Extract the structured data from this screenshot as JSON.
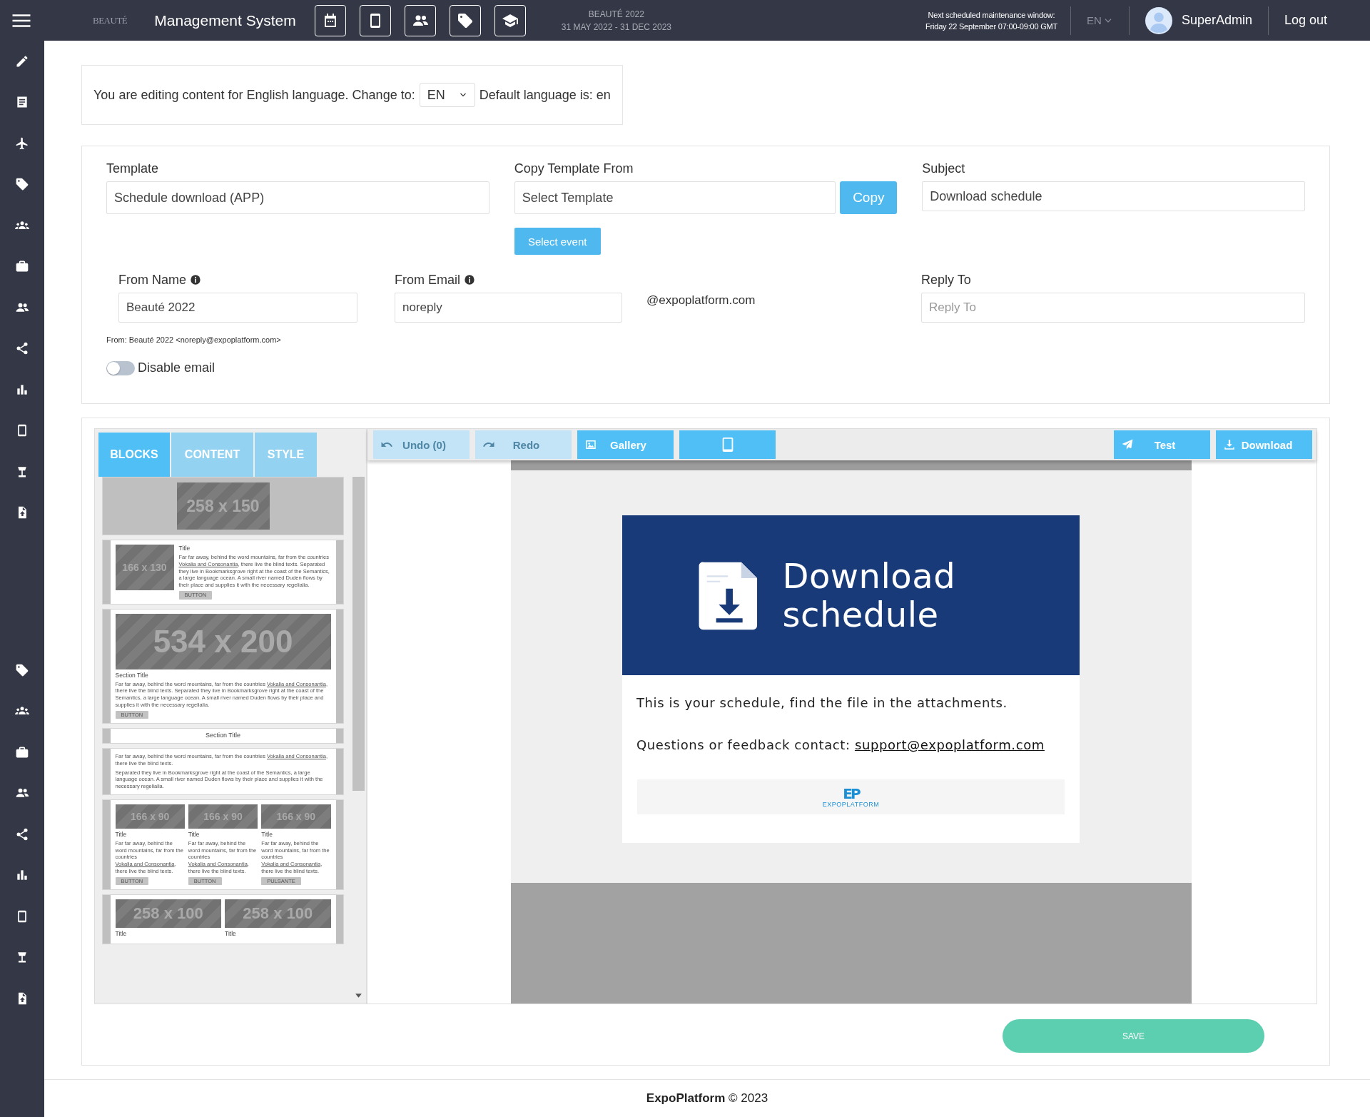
{
  "topbar": {
    "logo": "BEAUTÉ",
    "title": "Management System",
    "event_name": "BEAUTÉ 2022",
    "event_dates": "31 MAY 2022 - 31 DEC 2023",
    "maintenance_title": "Next scheduled maintenance window:",
    "maintenance_time": "Friday 22 September 07:00-09:00 GMT",
    "language": "EN",
    "user": "SuperAdmin",
    "logout": "Log out"
  },
  "language_bar": {
    "text": "You are editing content for English language. Change to:",
    "language": "EN",
    "default_text": "Default language is: en"
  },
  "form": {
    "template": {
      "label": "Template",
      "value": "Schedule download (APP)"
    },
    "copy_from": {
      "label": "Copy Template From",
      "value": "Select Template",
      "button": "Copy"
    },
    "subject": {
      "label": "Subject",
      "value": "Download schedule"
    },
    "select_event": "Select event",
    "from_name": {
      "label": "From Name",
      "value": "Beauté 2022"
    },
    "from_email": {
      "label": "From Email",
      "value": "noreply",
      "domain": "@expoplatform.com"
    },
    "reply_to": {
      "label": "Reply To",
      "placeholder": "Reply To"
    },
    "from_preview": "From: Beauté 2022 <noreply@expoplatform.com>",
    "disable_email": {
      "label": "Disable email",
      "on": false
    }
  },
  "editor": {
    "tabs": [
      {
        "label": "BLOCKS",
        "selected": true
      },
      {
        "label": "CONTENT",
        "selected": false
      },
      {
        "label": "STYLE",
        "selected": false
      }
    ],
    "blocks": [
      {
        "kind": "image",
        "image": "258 x 150"
      },
      {
        "kind": "image-text",
        "image": "166 x 130",
        "title": "Title",
        "text": "Far far away, behind the word mountains, far from the countries",
        "link": "Vokalia and Consonantia",
        "after": ", there live the blind texts. Separated they live in Bookmarksgrove right at the coast of the Semantics, a large language ocean. A small river named Duden flows by their place and supplies it with the necessary regelialia.",
        "button": "BUTTON"
      },
      {
        "kind": "hero",
        "image": "534 x 200",
        "title": "Section Title",
        "text": "Far far away, behind the word mountains, far from the countries",
        "link": "Vokalia and Consonantia",
        "after": ", there live the blind texts. Separated they live in Bookmarksgrove right at the coast of the Semantics, a large language ocean. A small river named Duden flows by their place and supplies it with the necessary regelialia.",
        "button": "BUTTON"
      },
      {
        "kind": "heading",
        "title": "Section Title"
      },
      {
        "kind": "text",
        "text": "Far far away, behind the word mountains, far from the countries",
        "link": "Vokalia and Consonantia",
        "after": ", there live the blind texts.",
        "paragraph_2": "Separated they live in Bookmarksgrove right at the coast of the Semantics, a large language ocean. A small river named Duden flows by their place and supplies it with the necessary regelialia."
      },
      {
        "kind": "columns",
        "columns": [
          {
            "image": "166 x 90",
            "title": "Title",
            "text": "Far far away, behind the word mountains, far from the countries",
            "link": "Vokalia and Consonantia",
            "after": ", there live the blind texts.",
            "button": "BUTTON"
          },
          {
            "image": "166 x 90",
            "title": "Title",
            "text": "Far far away, behind the word mountains, far from the countries",
            "link": "Vokalia and Consonantia",
            "after": ", there live the blind texts.",
            "button": "BUTTON"
          },
          {
            "image": "166 x 90",
            "title": "Title",
            "text": "Far far away, behind the word mountains, far from the countries",
            "link": "Vokalia and Consonantia",
            "after": ", there live the blind texts.",
            "button": "PULSANTE"
          }
        ]
      },
      {
        "kind": "columns",
        "columns": [
          {
            "image": "258 x 100",
            "title": "Title"
          },
          {
            "image": "258 x 100",
            "title": "Title"
          }
        ]
      }
    ],
    "toolbar": [
      {
        "kind": "undo",
        "label": "Undo (0)",
        "disabled": true
      },
      {
        "kind": "redo",
        "label": "Redo",
        "disabled": true
      },
      {
        "kind": "gallery",
        "label": "Gallery",
        "disabled": false
      },
      {
        "kind": "preview",
        "disabled": false
      },
      {
        "kind": "test",
        "label": "Test",
        "disabled": false
      },
      {
        "kind": "download",
        "label": "Download",
        "disabled": false
      }
    ],
    "email": {
      "title": "Download schedule",
      "text": "This is your schedule, find the file in the attachments.",
      "contact_text": "Questions or feedback contact:",
      "contact_link": "support@expoplatform.com",
      "logo_mark": "EP",
      "logo_text": "EXPOPLATFORM"
    }
  },
  "save_button": "SAVE",
  "footer": "**ExpoPlatform** © 2023"
}
